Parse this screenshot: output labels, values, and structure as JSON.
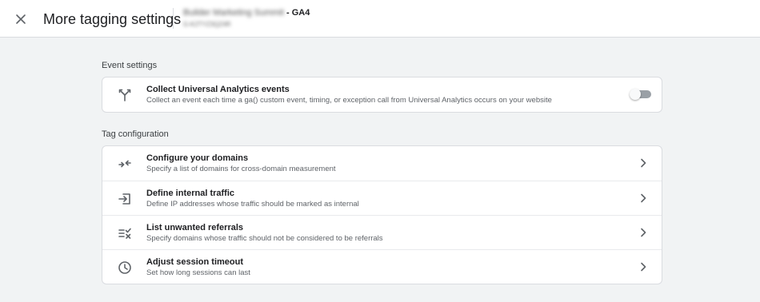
{
  "header": {
    "close_icon": "close-icon",
    "title": "More tagging settings",
    "property_name_blurred": "Builder Marketing Summit",
    "stream_suffix": " - GA4",
    "property_id_blurred": "G-K2TYZ3QZ4R"
  },
  "event_settings": {
    "label": "Event settings",
    "items": [
      {
        "icon": "fork-merge-icon",
        "title": "Collect Universal Analytics events",
        "description": "Collect an event each time a ga() custom event, timing, or exception call from Universal Analytics occurs on your website",
        "toggle_on": false
      }
    ]
  },
  "tag_configuration": {
    "label": "Tag configuration",
    "items": [
      {
        "icon": "arrows-inward-icon",
        "title": "Configure your domains",
        "description": "Specify a list of domains for cross-domain measurement"
      },
      {
        "icon": "login-arrow-icon",
        "title": "Define internal traffic",
        "description": "Define IP addresses whose traffic should be marked as internal"
      },
      {
        "icon": "list-check-icon",
        "title": "List unwanted referrals",
        "description": "Specify domains whose traffic should not be considered to be referrals"
      },
      {
        "icon": "clock-icon",
        "title": "Adjust session timeout",
        "description": "Set how long sessions can last"
      }
    ]
  },
  "colors": {
    "background": "#f1f3f4",
    "card": "#ffffff",
    "text_primary": "#202124",
    "text_secondary": "#5f6368",
    "icon": "#5f6368",
    "toggle_off_track": "#9aa0a6"
  }
}
